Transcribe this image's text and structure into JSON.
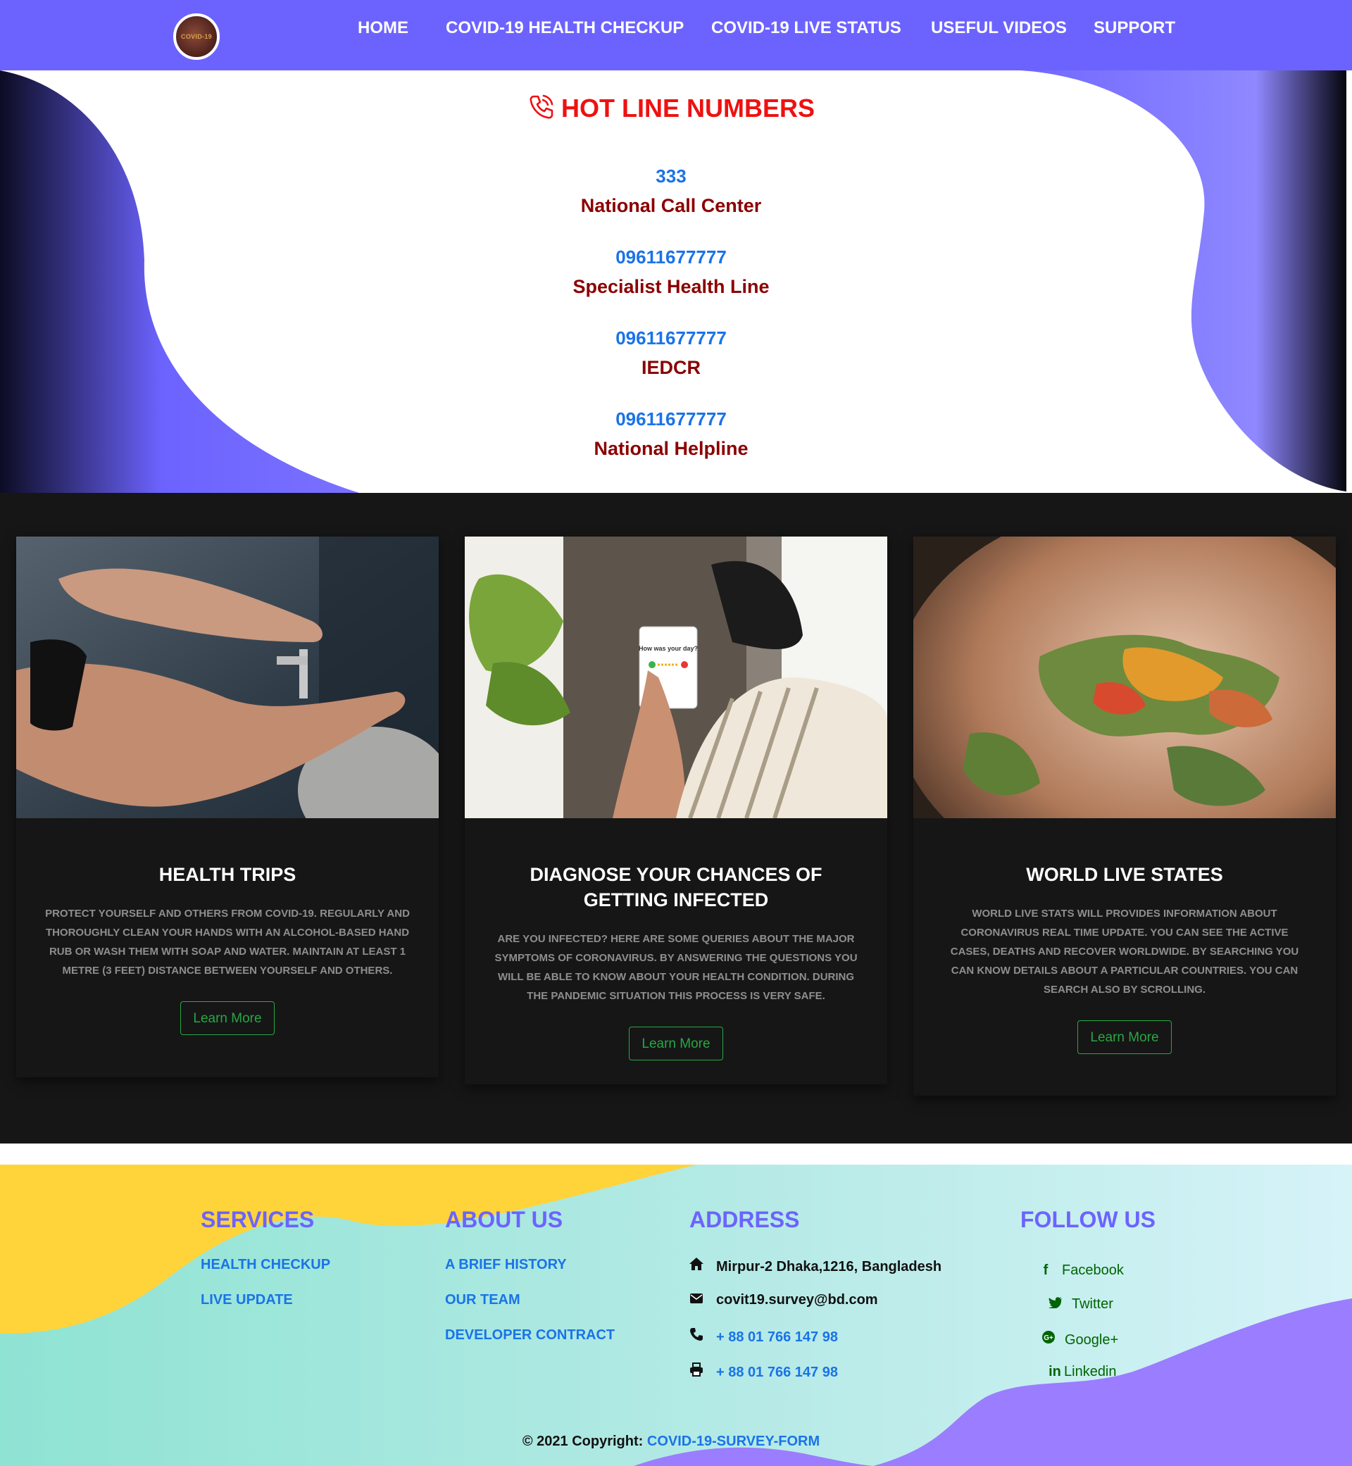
{
  "navbar": {
    "logo_text": "COVID-19",
    "links": [
      "HOME",
      "COVID-19 HEALTH CHECKUP",
      "COVID-19 LIVE STATUS",
      "USEFUL VIDEOS",
      "SUPPORT"
    ]
  },
  "hotline": {
    "title": "HOT LINE NUMBERS",
    "icon": "phone-ringing-icon",
    "entries": [
      {
        "number": "333",
        "label": "National Call Center"
      },
      {
        "number": "09611677777",
        "label": "Specialist Health Line"
      },
      {
        "number": "09611677777",
        "label": "IEDCR"
      },
      {
        "number": "09611677777",
        "label": "National Helpline"
      }
    ]
  },
  "cards": [
    {
      "title": "HEALTH TRIPS",
      "text": "PROTECT YOURSELF AND OTHERS FROM COVID-19. REGULARLY AND THOROUGHLY CLEAN YOUR HANDS WITH AN ALCOHOL-BASED HAND RUB OR WASH THEM WITH SOAP AND WATER. MAINTAIN AT LEAST 1 METRE (3 FEET) DISTANCE BETWEEN YOURSELF AND OTHERS.",
      "button": "Learn More"
    },
    {
      "title": "DIAGNOSE YOUR CHANCES OF GETTING INFECTED",
      "text": "ARE YOU INFECTED? HERE ARE SOME QUERIES ABOUT THE MAJOR SYMPTOMS OF CORONAVIRUS. BY ANSWERING THE QUESTIONS YOU WILL BE ABLE TO KNOW ABOUT YOUR HEALTH CONDITION. DURING THE PANDEMIC SITUATION THIS PROCESS IS VERY SAFE.",
      "button": "Learn More",
      "image_text": "How was your day?"
    },
    {
      "title": "WORLD LIVE STATES",
      "text": "WORLD LIVE STATS WILL PROVIDES INFORMATION ABOUT CORONAVIRUS REAL TIME UPDATE. YOU CAN SEE THE ACTIVE CASES, DEATHS AND RECOVER WORLDWIDE. BY SEARCHING YOU CAN KNOW DETAILS ABOUT A PARTICULAR COUNTRIES. YOU CAN SEARCH ALSO BY SCROLLING.",
      "button": "Learn More"
    }
  ],
  "footer": {
    "services": {
      "heading": "SERVICES",
      "links": [
        "HEALTH CHECKUP",
        "LIVE UPDATE"
      ]
    },
    "about": {
      "heading": "ABOUT US",
      "links": [
        "A BRIEF HISTORY",
        "OUR TEAM",
        "DEVELOPER CONTRACT"
      ]
    },
    "address": {
      "heading": "ADDRESS",
      "location": "Mirpur-2 Dhaka,1216, Bangladesh",
      "email": "covit19.survey@bd.com",
      "phone": "+ 88 01 766 147 98",
      "fax": "+ 88 01 766 147 98"
    },
    "follow": {
      "heading": "FOLLOW US",
      "links": [
        {
          "icon": "facebook-icon",
          "label": "Facebook"
        },
        {
          "icon": "twitter-icon",
          "label": "Twitter"
        },
        {
          "icon": "google-plus-icon",
          "label": "Google+"
        },
        {
          "icon": "linkedin-icon",
          "label": "Linkedin"
        }
      ]
    },
    "copyright_prefix": "© 2021 Copyright:",
    "copyright_link": "COVID-19-SURVEY-FORM"
  },
  "colors": {
    "nav_bg": "#6c63ff",
    "hotline_title": "#ee1111",
    "number_blue": "#1a73e8",
    "label_red": "#8b0000",
    "button_green": "#28a745",
    "footer_heading": "#6c63ff"
  }
}
